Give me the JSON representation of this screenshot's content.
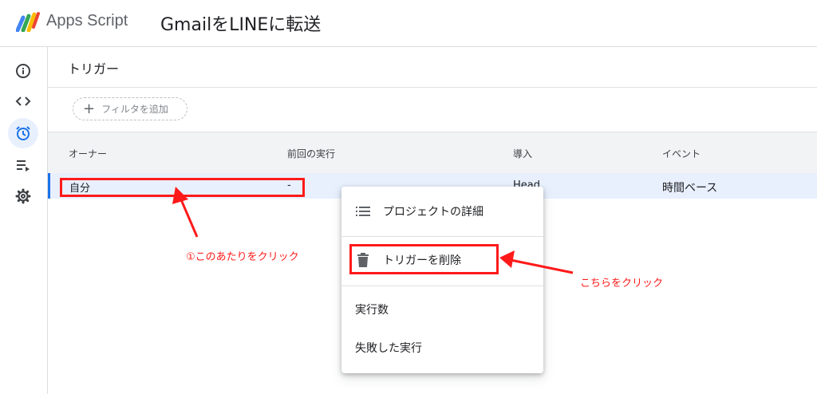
{
  "header": {
    "app_name": "Apps Script",
    "project_title": "GmailをLINEに転送"
  },
  "sidebar": {
    "items": [
      {
        "name": "overview",
        "icon": "info-icon"
      },
      {
        "name": "editor",
        "icon": "code-icon"
      },
      {
        "name": "triggers",
        "icon": "alarm-clock-icon",
        "active": true
      },
      {
        "name": "executions",
        "icon": "executions-list-icon"
      },
      {
        "name": "settings",
        "icon": "gear-icon"
      }
    ]
  },
  "main": {
    "page_title": "トリガー",
    "filter_label": "フィルタを追加",
    "table": {
      "headers": [
        "オーナー",
        "前回の実行",
        "導入",
        "イベント"
      ],
      "rows": [
        {
          "owner": "自分",
          "last_run": "-",
          "deployment": "Head",
          "event": "時間ベース"
        }
      ]
    }
  },
  "context_menu": {
    "items": [
      {
        "label": "プロジェクトの詳細",
        "icon": "list-icon"
      },
      {
        "label": "トリガーを削除",
        "icon": "trash-icon"
      },
      {
        "label": "実行数"
      },
      {
        "label": "失敗した実行"
      }
    ]
  },
  "annotations": {
    "row_hint": "①このあたりをクリック",
    "delete_hint": "こちらをクリック",
    "color": "#ff1a1a"
  },
  "colors": {
    "accent": "#1a73e8",
    "selected_row": "#e8f0fe",
    "header_bg": "#f1f3f4"
  }
}
